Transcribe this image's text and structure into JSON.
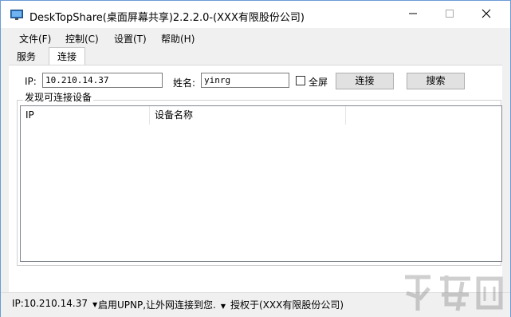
{
  "window": {
    "title": "DeskTopShare(桌面屏幕共享)2.2.2.0-(XXX有限股份公司)"
  },
  "menu": {
    "items": [
      "文件(F)",
      "控制(C)",
      "设置(T)",
      "帮助(H)"
    ]
  },
  "tabs": {
    "items": [
      "服务",
      "连接"
    ],
    "active": "连接"
  },
  "connect": {
    "ip_label": "IP:",
    "ip_value": "10.210.14.37",
    "name_label": "姓名:",
    "name_value": "yinrg",
    "fullscreen_label": "全屏",
    "fullscreen_checked": false,
    "connect_button": "连接",
    "search_button": "搜索"
  },
  "devices": {
    "group_title": "发现可连接设备",
    "columns": [
      "IP",
      "设备名称"
    ],
    "rows": []
  },
  "status": {
    "ip_text": "IP:10.210.14.37",
    "upnp_text": "启用UPNP,让外网连接到您.",
    "license_text": "授权于(XXX有限股份公司)"
  },
  "icons": {
    "app": "monitor-icon",
    "minimize": "minimize-icon",
    "maximize": "maximize-icon",
    "close": "close-icon",
    "dropdown": "caret-down-icon"
  }
}
